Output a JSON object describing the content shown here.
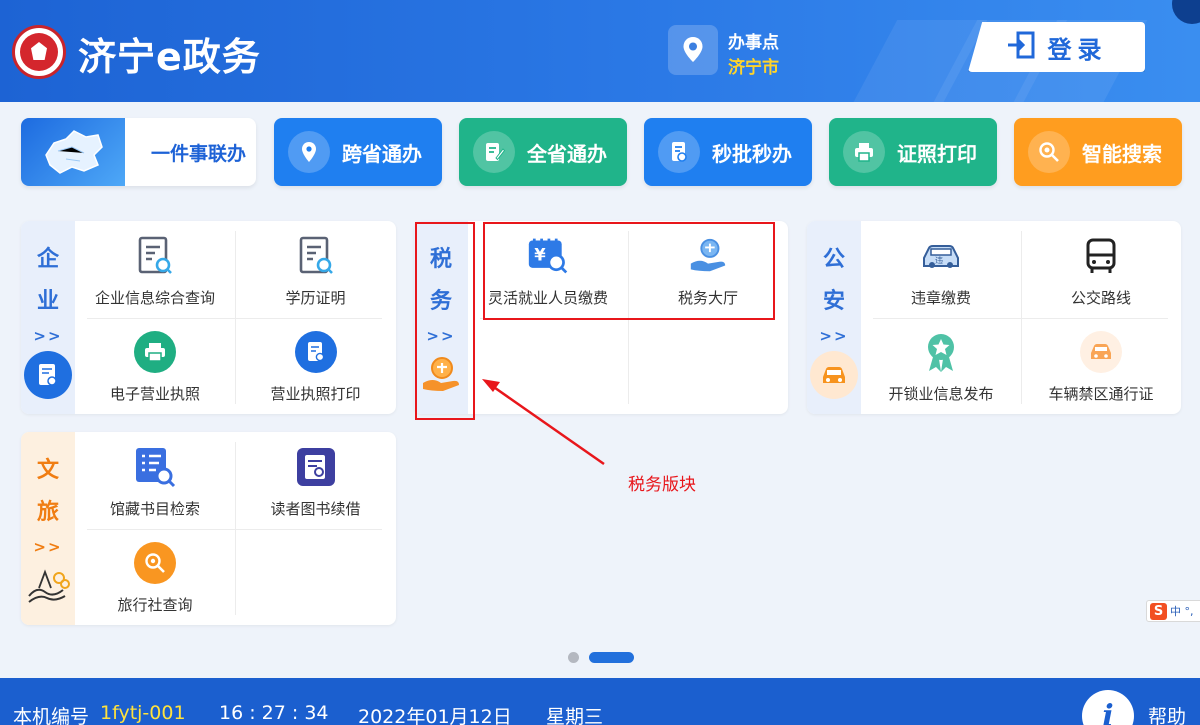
{
  "header": {
    "app_title": "济宁e政务",
    "location_label": "办事点",
    "location_city": "济宁市",
    "login_label": "登录",
    "icons": [
      "emblem-seal-icon",
      "location-pin-icon",
      "login-door-icon"
    ]
  },
  "nav_tiles": [
    {
      "label": "一件事联办",
      "color": "#ffffff",
      "icon": "province-map-icon"
    },
    {
      "label": "跨省通办",
      "color": "#1f7ff0",
      "icon": "map-pin-icon"
    },
    {
      "label": "全省通办",
      "color": "#20b48a",
      "icon": "edit-document-icon"
    },
    {
      "label": "秒批秒办",
      "color": "#1f7ff0",
      "icon": "approval-document-icon"
    },
    {
      "label": "证照打印",
      "color": "#20b48a",
      "icon": "printer-icon"
    },
    {
      "label": "智能搜索",
      "color": "#ff9d1f",
      "icon": "smart-search-icon"
    }
  ],
  "panels": {
    "enterprise": {
      "title_chars": [
        "企",
        "业"
      ],
      "arrows": ">>",
      "items": [
        "企业信息综合查询",
        "学历证明",
        "电子营业执照",
        "营业执照打印"
      ]
    },
    "tax": {
      "title_chars": [
        "税",
        "务"
      ],
      "arrows": ">>",
      "items": [
        "灵活就业人员缴费",
        "税务大厅"
      ]
    },
    "police": {
      "title_chars": [
        "公",
        "安"
      ],
      "arrows": ">>",
      "items": [
        "违章缴费",
        "公交路线",
        "开锁业信息发布",
        "车辆禁区通行证"
      ]
    },
    "culture": {
      "title_chars": [
        "文",
        "旅"
      ],
      "arrows": ">>",
      "items": [
        "馆藏书目检索",
        "读者图书续借",
        "旅行社查询"
      ]
    }
  },
  "annotation": {
    "text": "税务版块"
  },
  "ime": {
    "text": "中 °,"
  },
  "footer": {
    "machine_label": "本机编号",
    "machine_id": "1fytj-001",
    "time": "16 : 27 : 34",
    "date": "2022年01月12日",
    "weekday": "星期三",
    "help_label": "帮助",
    "help_icon": "i"
  },
  "colors": {
    "header_blue": "#2270dc",
    "footer_blue": "#1b5fcf",
    "annotation_red": "#e8161b",
    "accent_yellow": "#ffd42a"
  }
}
